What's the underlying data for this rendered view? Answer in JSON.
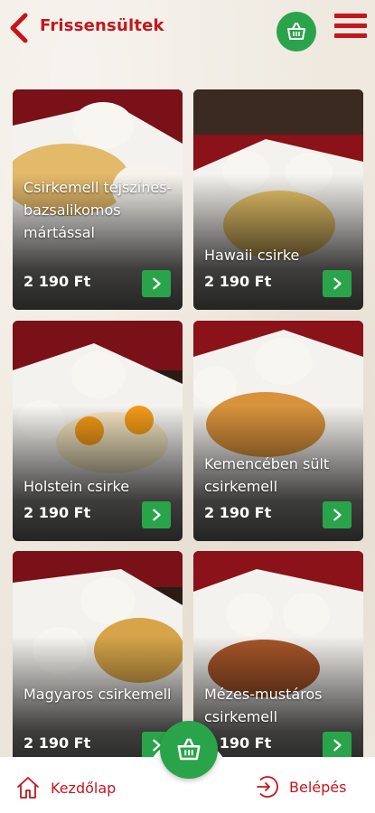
{
  "header": {
    "title": "Frissensültek",
    "back_icon": "chevron-left-icon",
    "cart_icon": "basket-icon",
    "menu_icon": "hamburger-menu-icon"
  },
  "products": [
    {
      "name": "Csirkemell tejszínes-bazsalikomos mártással",
      "price": "2 190 Ft"
    },
    {
      "name": "Hawaii csirke",
      "price": "2 190 Ft"
    },
    {
      "name": "Holstein csirke",
      "price": "2 190 Ft"
    },
    {
      "name": "Kemencében sült csirkemell",
      "price": "2 190 Ft"
    },
    {
      "name": "Magyaros csirkemell",
      "price": "2 190 Ft"
    },
    {
      "name": "Mézes-mustáros csirkemell",
      "price": "2 190 Ft"
    }
  ],
  "bottom_nav": {
    "home_label": "Kezdőlap",
    "login_label": "Belépés",
    "cart_icon": "basket-icon"
  },
  "colors": {
    "brand_red": "#c4161c",
    "accent_green": "#2aa44a"
  }
}
